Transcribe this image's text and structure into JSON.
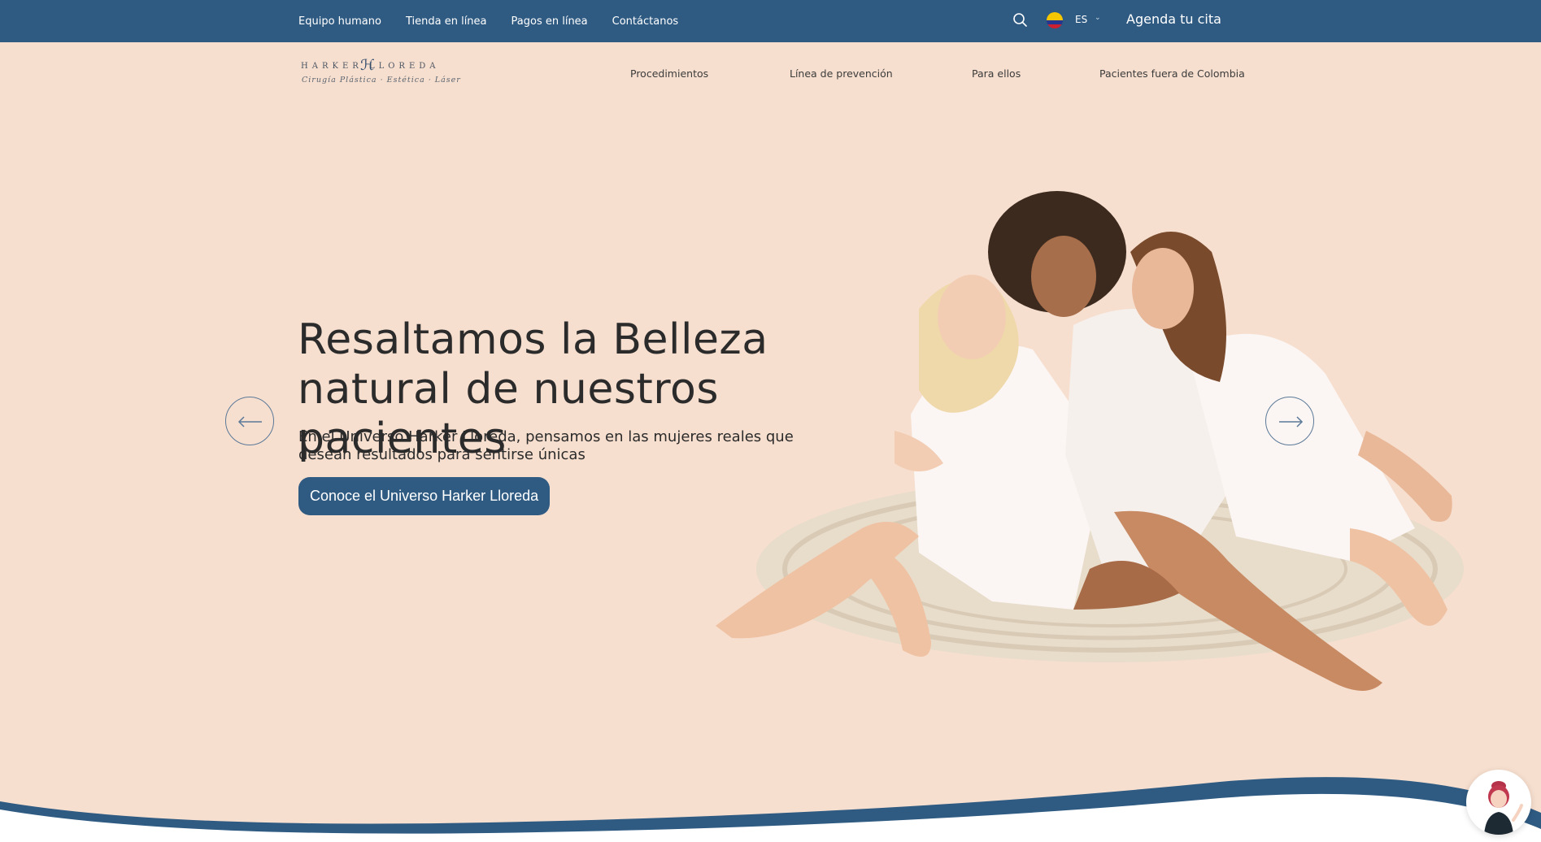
{
  "topbar": {
    "links": [
      "Equipo humano",
      "Tienda en línea",
      "Pagos en línea",
      "Contáctanos"
    ],
    "search_icon": "search-icon",
    "flag_icon": "colombia-flag-icon",
    "language": "ES",
    "cta": "Agenda tu cita",
    "color": "#2f5b83"
  },
  "logo": {
    "wordmark": "HARKER LLOREDA",
    "tagline": "Cirugía Plástica · Estética · Láser"
  },
  "mainnav": {
    "items": [
      "Procedimientos",
      "Línea de prevención",
      "Para ellos",
      "Pacientes fuera de Colombia"
    ]
  },
  "hero": {
    "title": "Resaltamos la Belleza natural de nuestros pacientes",
    "subtitle": "En el Universo Harker Lloreda, pensamos en las mujeres reales que desean resultados para sentirse únicas",
    "button": "Conoce el Universo Harker Lloreda",
    "prev_icon": "arrow-left-icon",
    "next_icon": "arrow-right-icon",
    "background": "#f7dfcf"
  },
  "chat": {
    "icon": "chat-assistant-avatar-icon"
  }
}
